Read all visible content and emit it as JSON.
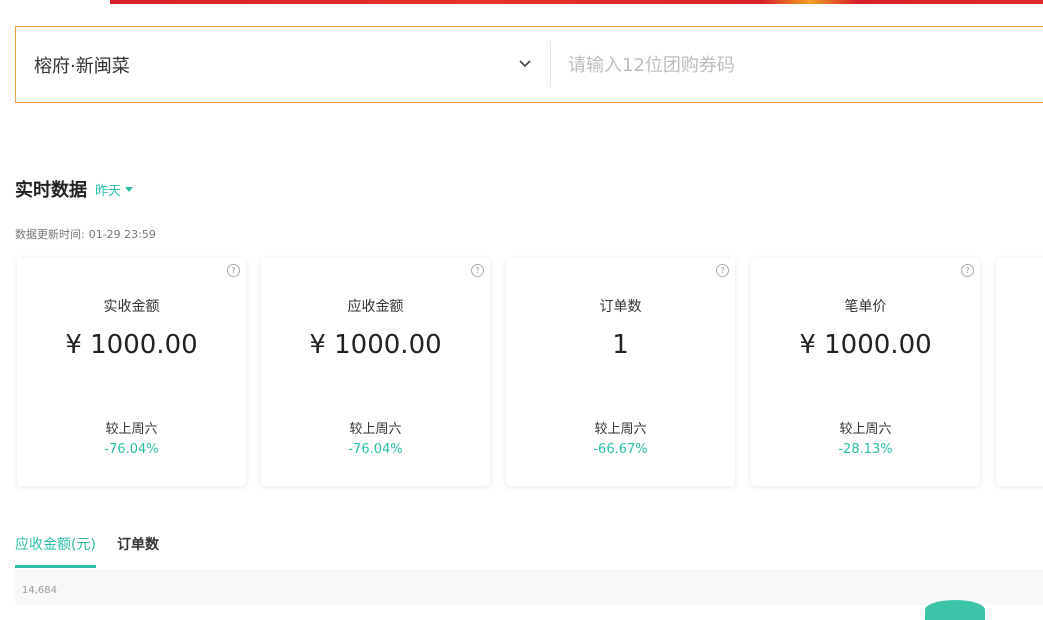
{
  "search": {
    "store_name": "榕府·新闽菜",
    "coupon_placeholder": "请输入12位团购券码"
  },
  "realtime": {
    "title": "实时数据",
    "date_filter": "昨天",
    "update_label": "数据更新时间:",
    "update_time": "01-29 23:59"
  },
  "cards": [
    {
      "label": "实收金额",
      "value": "¥ 1000.00",
      "compare": "较上周六",
      "change": "-76.04%"
    },
    {
      "label": "应收金额",
      "value": "¥ 1000.00",
      "compare": "较上周六",
      "change": "-76.04%"
    },
    {
      "label": "订单数",
      "value": "1",
      "compare": "较上周六",
      "change": "-66.67%"
    },
    {
      "label": "笔单价",
      "value": "¥ 1000.00",
      "compare": "较上周六",
      "change": "-28.13%"
    }
  ],
  "tabs": [
    {
      "label": "应收金额(元)",
      "active": true
    },
    {
      "label": "订单数",
      "active": false
    }
  ],
  "chart": {
    "top_tick": "14,684"
  },
  "colors": {
    "accent": "#2bbfa8",
    "search_border": "#f0a24a",
    "banner": "#d9202a"
  },
  "icons": {
    "dropdown": "chevron-down-icon",
    "help": "question-circle-icon",
    "date_caret": "caret-down-icon"
  }
}
